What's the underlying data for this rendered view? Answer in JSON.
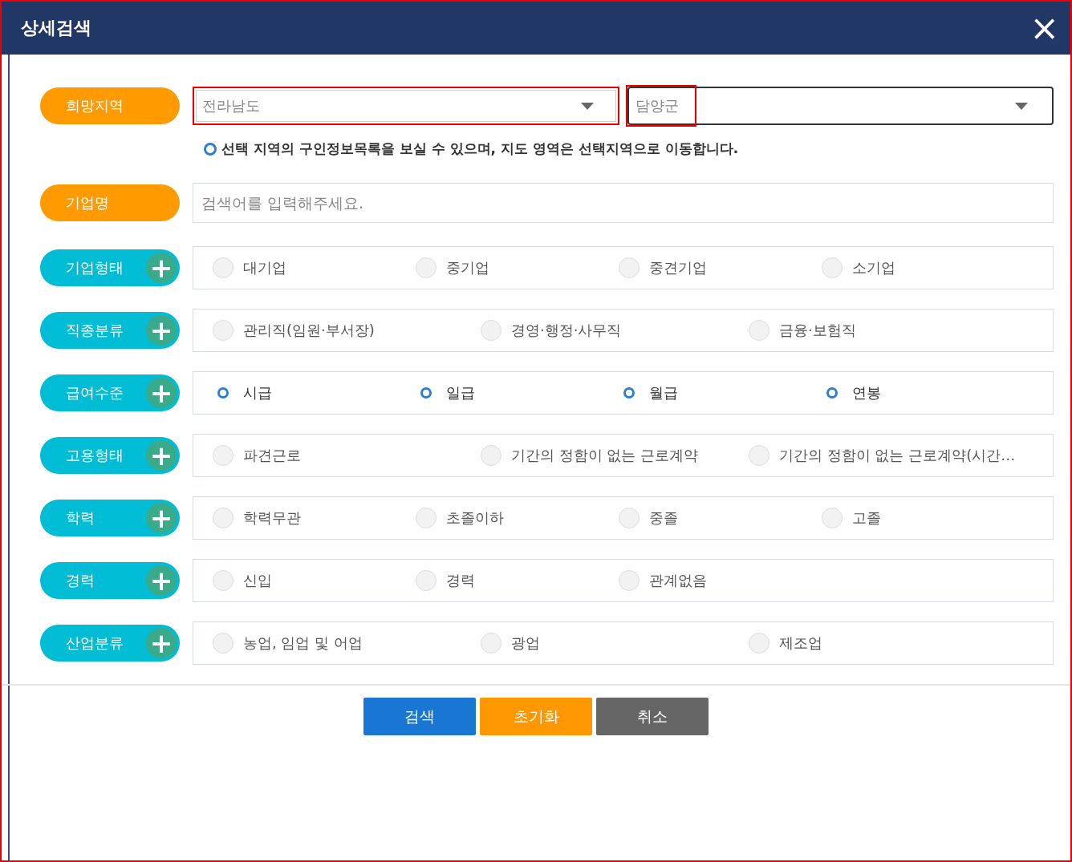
{
  "dialog": {
    "title": "상세검색",
    "close": "×"
  },
  "region": {
    "label": "희망지역",
    "selects": [
      {
        "value": "전라남도",
        "outlined": true,
        "value_outlined": false,
        "focused": false
      },
      {
        "value": "담양군",
        "outlined": false,
        "value_outlined": true,
        "focused": true
      }
    ],
    "note": "선택 지역의 구인정보목록을 보실 수 있으며, 지도 영역은 선택지역으로 이동합니다."
  },
  "company_name": {
    "label": "기업명",
    "placeholder": "검색어를 입력해주세요."
  },
  "filters": [
    {
      "label": "기업형태",
      "add": "+",
      "kind": "quad",
      "options": [
        {
          "label": "대기업",
          "selected": false
        },
        {
          "label": "중기업",
          "selected": false
        },
        {
          "label": "중견기업",
          "selected": false
        },
        {
          "label": "소기업",
          "selected": false
        }
      ]
    },
    {
      "label": "직종분류",
      "add": "+",
      "kind": "triple",
      "options": [
        {
          "label": "관리직(임원·부서장)",
          "selected": false
        },
        {
          "label": "경영·행정·사무직",
          "selected": false
        },
        {
          "label": "금융·보험직",
          "selected": false
        }
      ]
    },
    {
      "label": "급여수준",
      "add": "+",
      "kind": "quad",
      "options": [
        {
          "label": "시급",
          "selected": true
        },
        {
          "label": "일급",
          "selected": true
        },
        {
          "label": "월급",
          "selected": true
        },
        {
          "label": "연봉",
          "selected": true
        }
      ]
    },
    {
      "label": "고용형태",
      "add": "+",
      "kind": "triple",
      "options": [
        {
          "label": "파견근로",
          "selected": false
        },
        {
          "label": "기간의 정함이 없는 근로계약",
          "selected": false
        },
        {
          "label": "기간의 정함이 없는 근로계약(시간…",
          "selected": false
        }
      ]
    },
    {
      "label": "학력",
      "add": "+",
      "kind": "quad",
      "options": [
        {
          "label": "학력무관",
          "selected": false
        },
        {
          "label": "초졸이하",
          "selected": false
        },
        {
          "label": "중졸",
          "selected": false
        },
        {
          "label": "고졸",
          "selected": false
        }
      ]
    },
    {
      "label": "경력",
      "add": "+",
      "kind": "quad",
      "options": [
        {
          "label": "신입",
          "selected": false
        },
        {
          "label": "경력",
          "selected": false
        },
        {
          "label": "관계없음",
          "selected": false
        }
      ]
    },
    {
      "label": "산업분류",
      "add": "+",
      "kind": "triple",
      "options": [
        {
          "label": "농업, 임업 및 어업",
          "selected": false
        },
        {
          "label": "광업",
          "selected": false
        },
        {
          "label": "제조업",
          "selected": false
        }
      ]
    }
  ],
  "buttons": [
    {
      "label": "검색",
      "color": "#1976d2"
    },
    {
      "label": "초기화",
      "color": "#ff9800"
    },
    {
      "label": "취소",
      "color": "#666666"
    }
  ]
}
